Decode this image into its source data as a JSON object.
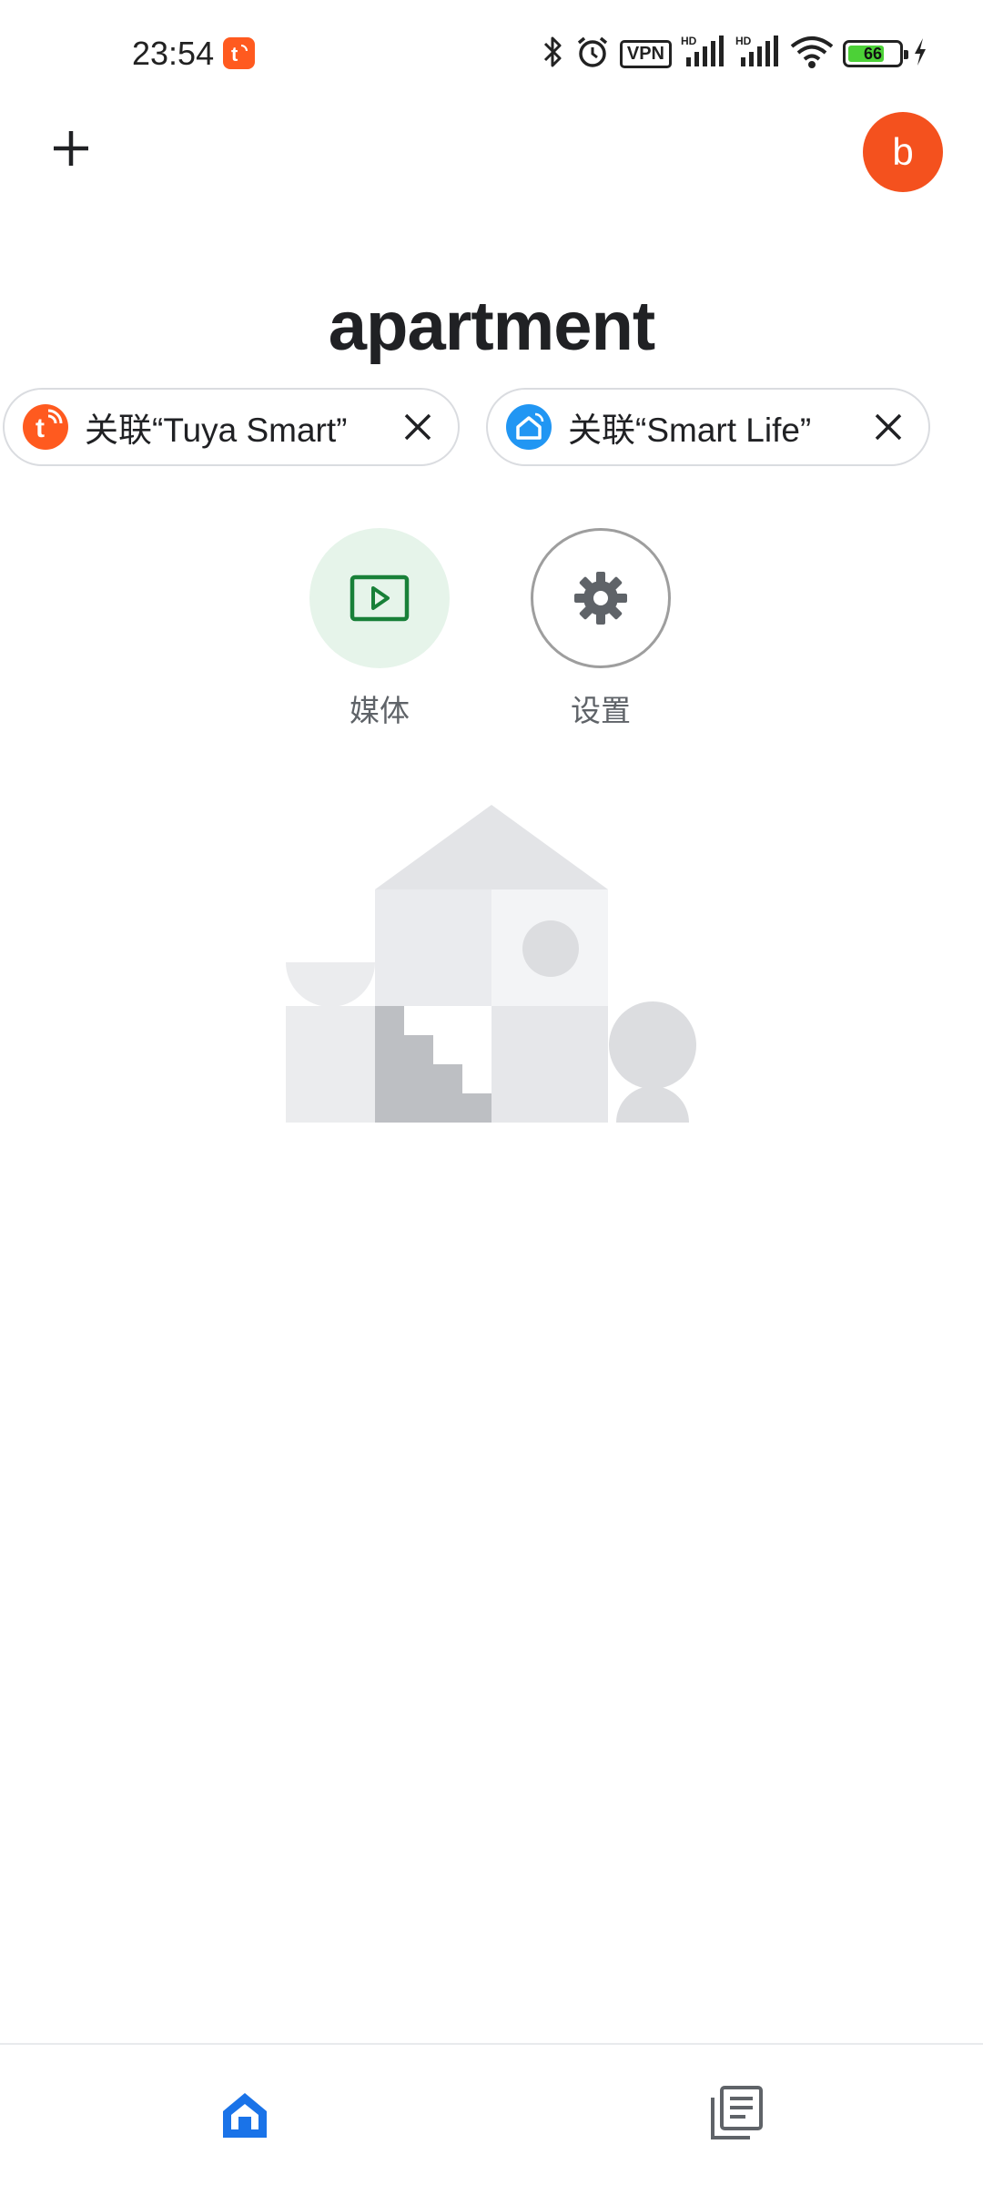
{
  "status_bar": {
    "time": "23:54",
    "vpn": "VPN",
    "battery_level": "66",
    "battery_fraction": 0.66,
    "icons": [
      "tuya-notification-icon",
      "bluetooth-icon",
      "alarm-icon",
      "vpn-icon",
      "hd-signal-icon",
      "hd-signal-icon",
      "wifi-icon",
      "battery-icon",
      "charging-icon"
    ]
  },
  "header": {
    "avatar_letter": "b",
    "title": "apartment"
  },
  "chips": [
    {
      "label": "关联“Tuya Smart”",
      "logo": "tuya-logo-icon",
      "color": "#ff5a1f"
    },
    {
      "label": "关联“Smart Life”",
      "logo": "smart-life-logo-icon",
      "color": "#2196f3"
    }
  ],
  "actions": {
    "media_label": "媒体",
    "settings_label": "设置"
  },
  "bottom_nav": {
    "items": [
      "home-icon",
      "feed-icon"
    ],
    "active": "home-icon"
  },
  "colors": {
    "accent": "#1a73e8",
    "avatar": "#f4511e",
    "media": "#188038",
    "media_bg": "#e6f4ea"
  }
}
